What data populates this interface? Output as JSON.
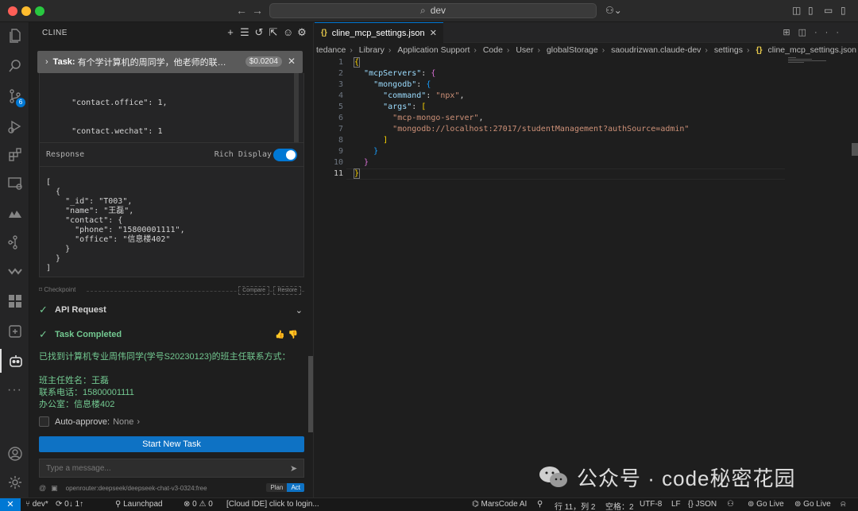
{
  "titlebar": {
    "command_center": "dev"
  },
  "activity": {
    "scm_badge": "6"
  },
  "panel": {
    "title": "CLINE",
    "task_label": "Task:",
    "task_text": "有个学计算机的周同学，他老师的联系方式...",
    "task_cost": "$0.0204",
    "code_snippet_lines": [
      "    \"contact.office\": 1,",
      "    \"contact.wechat\": 1",
      "  }",
      "}"
    ],
    "response_label": "Response",
    "rich_display_label": "Rich Display",
    "rich_display_on": true,
    "response_lines": [
      "[",
      "  {",
      "    \"_id\": \"T003\",",
      "    \"name\": \"王磊\",",
      "    \"contact\": {",
      "      \"phone\": \"15800001111\",",
      "      \"office\": \"信息楼402\"",
      "    }",
      "  }",
      "]"
    ],
    "checkpoint_label": "Checkpoint",
    "compare_label": "Compare",
    "restore_label": "Restore",
    "api_request_label": "API Request",
    "task_completed_label": "Task Completed",
    "result_lines": [
      "已找到计算机专业周伟同学(学号S20230123)的班主任联系方式：",
      "",
      "班主任姓名：王磊",
      "联系电话：15800001111",
      "办公室：信息楼402"
    ],
    "auto_approve_label": "Auto-approve:",
    "auto_approve_value": "None",
    "start_new_task_label": "Start New Task",
    "message_placeholder": "Type a message...",
    "model_name": "openrouter:deepseek/deepseek-chat-v3-0324:free",
    "plan_label": "Plan",
    "act_label": "Act"
  },
  "editor": {
    "tab_name": "cline_mcp_settings.json",
    "breadcrumb": [
      "tedance",
      "Library",
      "Application Support",
      "Code",
      "User",
      "globalStorage",
      "saoudrizwan.claude-dev",
      "settings",
      "cline_mcp_settings.json"
    ],
    "line_numbers": [
      "1",
      "2",
      "3",
      "4",
      "5",
      "6",
      "7",
      "8",
      "9",
      "10",
      "11"
    ],
    "current_line_index": 10,
    "code": {
      "mcpServers_key": "\"mcpServers\"",
      "mongodb_key": "\"mongodb\"",
      "command_key": "\"command\"",
      "command_value": "\"npx\"",
      "args_key": "\"args\"",
      "arg1": "\"mcp-mongo-server\"",
      "arg2": "\"mongodb://localhost:27017/studentManagement?authSource=admin\""
    }
  },
  "watermark": {
    "text": "公众号 · code秘密花园"
  },
  "statusbar": {
    "branch": "dev*",
    "sync": "0↓ 1↑",
    "launchpad": "Launchpad",
    "errors": "0",
    "warnings": "0",
    "cloud_ide": "[Cloud IDE] click to login...",
    "marscode": "MarsCode AI",
    "position": "行 11，列 2",
    "spaces": "空格：2",
    "encoding": "UTF-8",
    "eol": "LF",
    "language": "JSON",
    "golive1": "Go Live",
    "golive2": "Go Live"
  },
  "colors": {
    "accent": "#0078d4",
    "success": "#73c991",
    "json_key": "#9cdcfe",
    "json_string": "#ce9178"
  }
}
